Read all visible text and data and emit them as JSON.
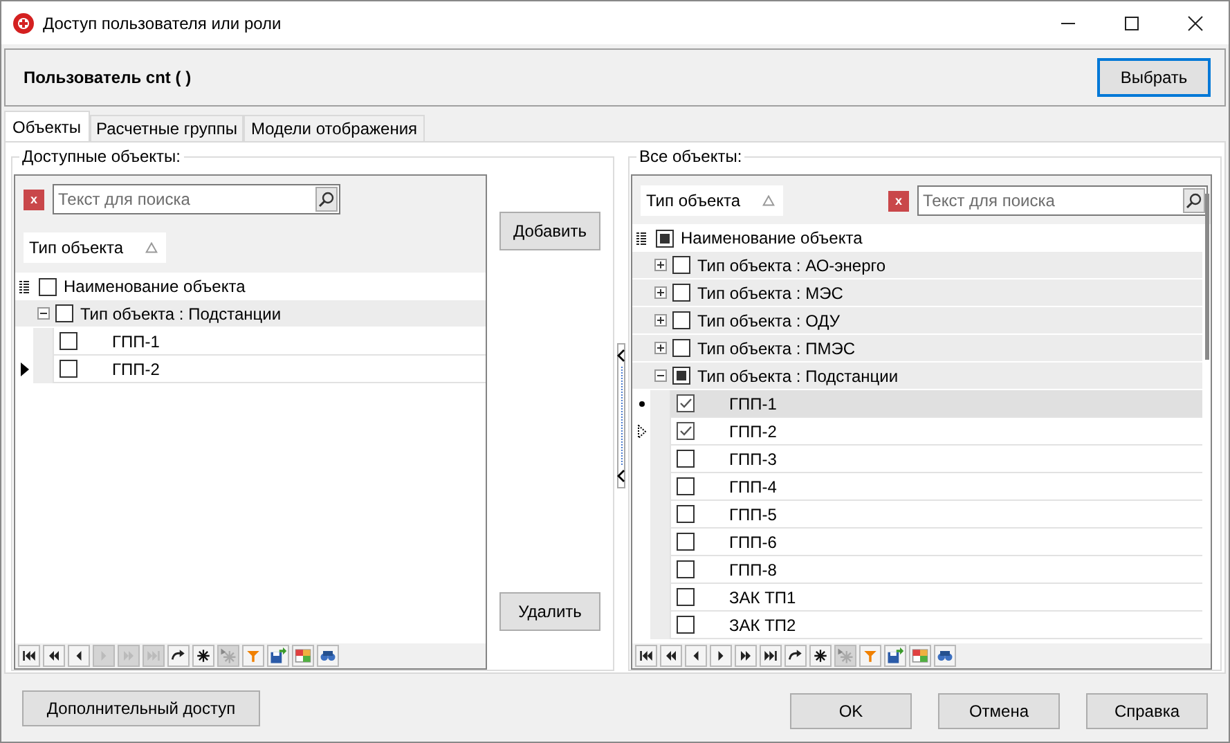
{
  "window": {
    "title": "Доступ пользователя или роли"
  },
  "header": {
    "user_label": "Пользователь cnt ( )",
    "button": "Выбрать"
  },
  "tabs": [
    {
      "label": "Объекты",
      "selected": true
    },
    {
      "label": "Расчетные группы",
      "selected": false
    },
    {
      "label": "Модели отображения",
      "selected": false
    }
  ],
  "left_panel": {
    "legend": "Доступные объекты:",
    "search": {
      "placeholder": "Текст для поиска",
      "clear": "x"
    },
    "group_chip": "Тип объекта",
    "column": {
      "label": "Наименование объекта",
      "checked": false,
      "partial": false
    },
    "rows": [
      {
        "kind": "group",
        "label": "Тип объекта : Подстанции",
        "expanded": true,
        "checked": false,
        "partial": false,
        "children": [
          {
            "kind": "item",
            "name": "ГПП-1",
            "checked": false,
            "selected": false,
            "current": false,
            "focused": false,
            "bullet": false
          },
          {
            "kind": "item",
            "name": "ГПП-2",
            "checked": false,
            "selected": false,
            "current": true,
            "focused": false,
            "bullet": false
          }
        ]
      }
    ],
    "navigator": [
      {
        "kind": "first",
        "disabled": false
      },
      {
        "kind": "prev-page",
        "disabled": false
      },
      {
        "kind": "prev",
        "disabled": false
      },
      {
        "kind": "next",
        "disabled": true
      },
      {
        "kind": "next-page",
        "disabled": true
      },
      {
        "kind": "last",
        "disabled": true
      },
      {
        "kind": "refresh",
        "disabled": false
      },
      {
        "kind": "append",
        "disabled": false
      },
      {
        "kind": "delete",
        "disabled": true
      },
      {
        "kind": "filter",
        "disabled": false
      },
      {
        "kind": "export",
        "disabled": false
      },
      {
        "kind": "layout",
        "disabled": false
      },
      {
        "kind": "find",
        "disabled": false
      }
    ]
  },
  "middle_buttons": {
    "add": "Добавить",
    "remove": "Удалить"
  },
  "right_panel": {
    "legend": "Все объекты:",
    "search": {
      "placeholder": "Текст для поиска",
      "clear": "x"
    },
    "group_chip": "Тип объекта",
    "column": {
      "label": "Наименование объекта",
      "checked": false,
      "partial": true
    },
    "rows": [
      {
        "kind": "group",
        "label": "Тип объекта : АО-энерго",
        "expanded": false,
        "checked": false,
        "partial": false
      },
      {
        "kind": "group",
        "label": "Тип объекта : МЭС",
        "expanded": false,
        "checked": false,
        "partial": false
      },
      {
        "kind": "group",
        "label": "Тип объекта : ОДУ",
        "expanded": false,
        "checked": false,
        "partial": false
      },
      {
        "kind": "group",
        "label": "Тип объекта : ПМЭС",
        "expanded": false,
        "checked": false,
        "partial": false
      },
      {
        "kind": "group",
        "label": "Тип объекта : Подстанции",
        "expanded": true,
        "checked": false,
        "partial": true,
        "children": [
          {
            "kind": "item",
            "name": "ГПП-1",
            "checked": true,
            "selected": true,
            "current": false,
            "focused": false,
            "bullet": true
          },
          {
            "kind": "item",
            "name": "ГПП-2",
            "checked": true,
            "selected": false,
            "current": false,
            "focused": true,
            "bullet": false
          },
          {
            "kind": "item",
            "name": "ГПП-3",
            "checked": false,
            "selected": false,
            "current": false,
            "focused": false,
            "bullet": false
          },
          {
            "kind": "item",
            "name": "ГПП-4",
            "checked": false,
            "selected": false,
            "current": false,
            "focused": false,
            "bullet": false
          },
          {
            "kind": "item",
            "name": "ГПП-5",
            "checked": false,
            "selected": false,
            "current": false,
            "focused": false,
            "bullet": false
          },
          {
            "kind": "item",
            "name": "ГПП-6",
            "checked": false,
            "selected": false,
            "current": false,
            "focused": false,
            "bullet": false
          },
          {
            "kind": "item",
            "name": "ГПП-8",
            "checked": false,
            "selected": false,
            "current": false,
            "focused": false,
            "bullet": false
          },
          {
            "kind": "item",
            "name": "ЗАК ТП1",
            "checked": false,
            "selected": false,
            "current": false,
            "focused": false,
            "bullet": false
          },
          {
            "kind": "item",
            "name": "ЗАК ТП2",
            "checked": false,
            "selected": false,
            "current": false,
            "focused": false,
            "bullet": false
          }
        ]
      }
    ],
    "navigator": [
      {
        "kind": "first",
        "disabled": false
      },
      {
        "kind": "prev-page",
        "disabled": false
      },
      {
        "kind": "prev",
        "disabled": false
      },
      {
        "kind": "next",
        "disabled": false
      },
      {
        "kind": "next-page",
        "disabled": false
      },
      {
        "kind": "last",
        "disabled": false
      },
      {
        "kind": "refresh",
        "disabled": false
      },
      {
        "kind": "append",
        "disabled": false
      },
      {
        "kind": "delete",
        "disabled": true
      },
      {
        "kind": "filter",
        "disabled": false
      },
      {
        "kind": "export",
        "disabled": false
      },
      {
        "kind": "layout",
        "disabled": false
      },
      {
        "kind": "find",
        "disabled": false
      }
    ]
  },
  "footer": {
    "extra_button": "Дополнительный доступ",
    "buttons": [
      "OK",
      "Отмена",
      "Справка"
    ]
  }
}
